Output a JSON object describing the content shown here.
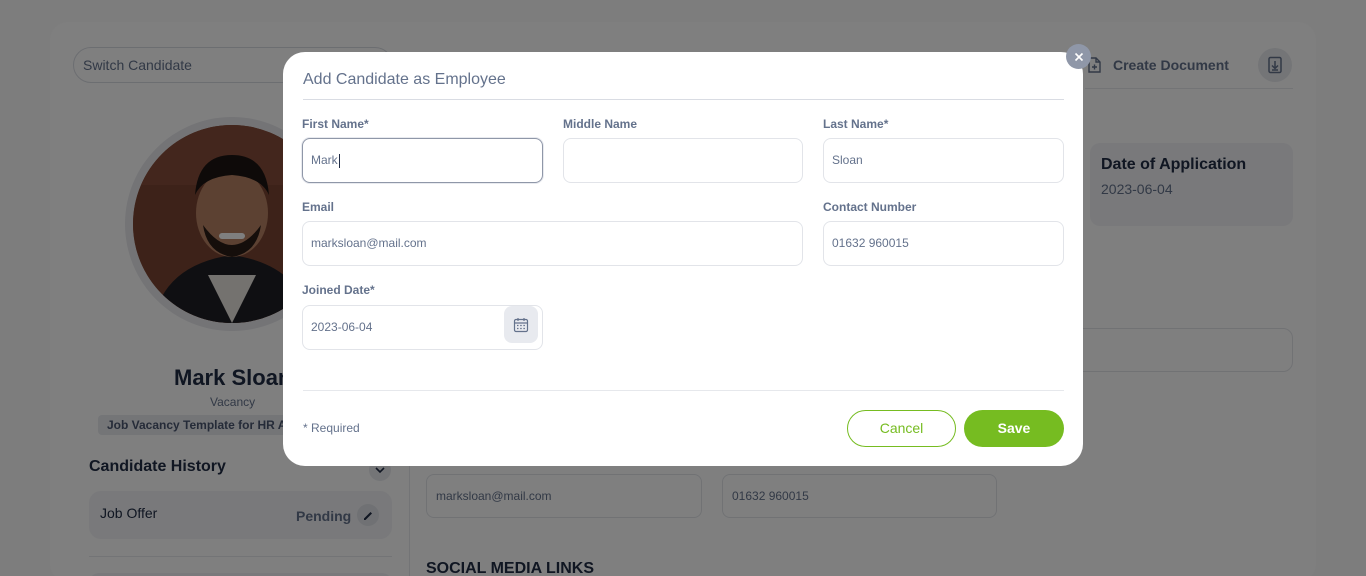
{
  "background": {
    "switch_candidate_placeholder": "Switch Candidate",
    "create_document_label": "Create Document",
    "candidate": {
      "name": "Mark Sloan",
      "vacancy_label": "Vacancy",
      "vacancy_badge": "Job Vacancy Template for HR A"
    },
    "candidate_history": {
      "title": "Candidate History",
      "items": [
        {
          "label": "Job Offer",
          "status": "Pending"
        }
      ]
    },
    "date_of_application": {
      "title": "Date of Application",
      "value": "2023-06-04"
    },
    "email_value": "marksloan@mail.com",
    "contact_value": "01632 960015",
    "social_media_title": "SOCIAL MEDIA LINKS"
  },
  "modal": {
    "title": "Add Candidate as Employee",
    "fields": {
      "first_name": {
        "label": "First Name*",
        "value": "Mark"
      },
      "middle_name": {
        "label": "Middle Name",
        "value": ""
      },
      "last_name": {
        "label": "Last Name*",
        "value": "Sloan"
      },
      "email": {
        "label": "Email",
        "value": "marksloan@mail.com"
      },
      "contact_number": {
        "label": "Contact Number",
        "value": "01632 960015"
      },
      "joined_date": {
        "label": "Joined Date*",
        "value": "2023-06-04"
      }
    },
    "required_note": "* Required",
    "cancel_label": "Cancel",
    "save_label": "Save"
  },
  "colors": {
    "accent": "#76bc21",
    "text_dark": "#202c45",
    "text_muted": "#64728c"
  }
}
